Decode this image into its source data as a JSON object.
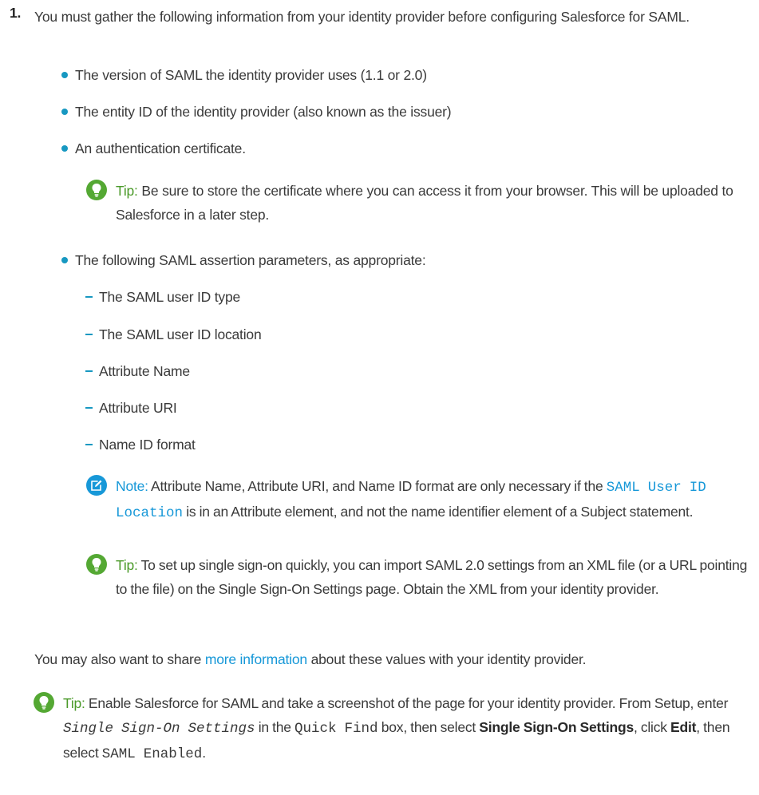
{
  "step": {
    "number": "1.",
    "text": "You must gather the following information from your identity provider before configuring Salesforce for SAML."
  },
  "bullets": [
    "The version of SAML the identity provider uses (1.1 or 2.0)",
    "The entity ID of the identity provider (also known as the issuer)",
    "An authentication certificate.",
    "The following SAML assertion parameters, as appropriate:"
  ],
  "tip1": {
    "label": "Tip:",
    "text": "Be sure to store the certificate where you can access it from your browser. This will be uploaded to Salesforce in a later step."
  },
  "params": [
    "The SAML user ID type",
    "The SAML user ID location",
    "Attribute Name",
    "Attribute URI",
    "Name ID format"
  ],
  "note": {
    "label": "Note:",
    "text_a": "Attribute Name, Attribute URI, and Name ID format are only necessary if the",
    "code": "SAML User ID Location",
    "text_b": "is in an Attribute element, and not the name identifier element of a Subject statement."
  },
  "tip2": {
    "label": "Tip:",
    "text": "To set up single sign-on quickly, you can import SAML 2.0 settings from an XML file (or a URL pointing to the file) on the Single Sign-On Settings page. Obtain the XML from your identity provider."
  },
  "share": {
    "text_a": "You may also want to share",
    "link": "more information",
    "text_b": "about these values with your identity provider."
  },
  "tip3": {
    "label": "Tip:",
    "text_a": "Enable Salesforce for SAML and take a screenshot of the page for your identity provider. From Setup, enter",
    "code_search": "Single Sign-On Settings",
    "text_b": "in the",
    "code_quickfind": "Quick Find",
    "text_c": "box, then select",
    "bold_settings": "Single Sign-On Settings",
    "text_d": ", click",
    "bold_edit": "Edit",
    "text_e": ", then select",
    "code_enabled": "SAML Enabled",
    "text_f": "."
  },
  "icons": {
    "tip": "lightbulb-icon",
    "note": "edit-note-icon"
  },
  "colors": {
    "accent": "#1798d8",
    "tip_green": "#54a833",
    "text": "#3a3a3a"
  }
}
